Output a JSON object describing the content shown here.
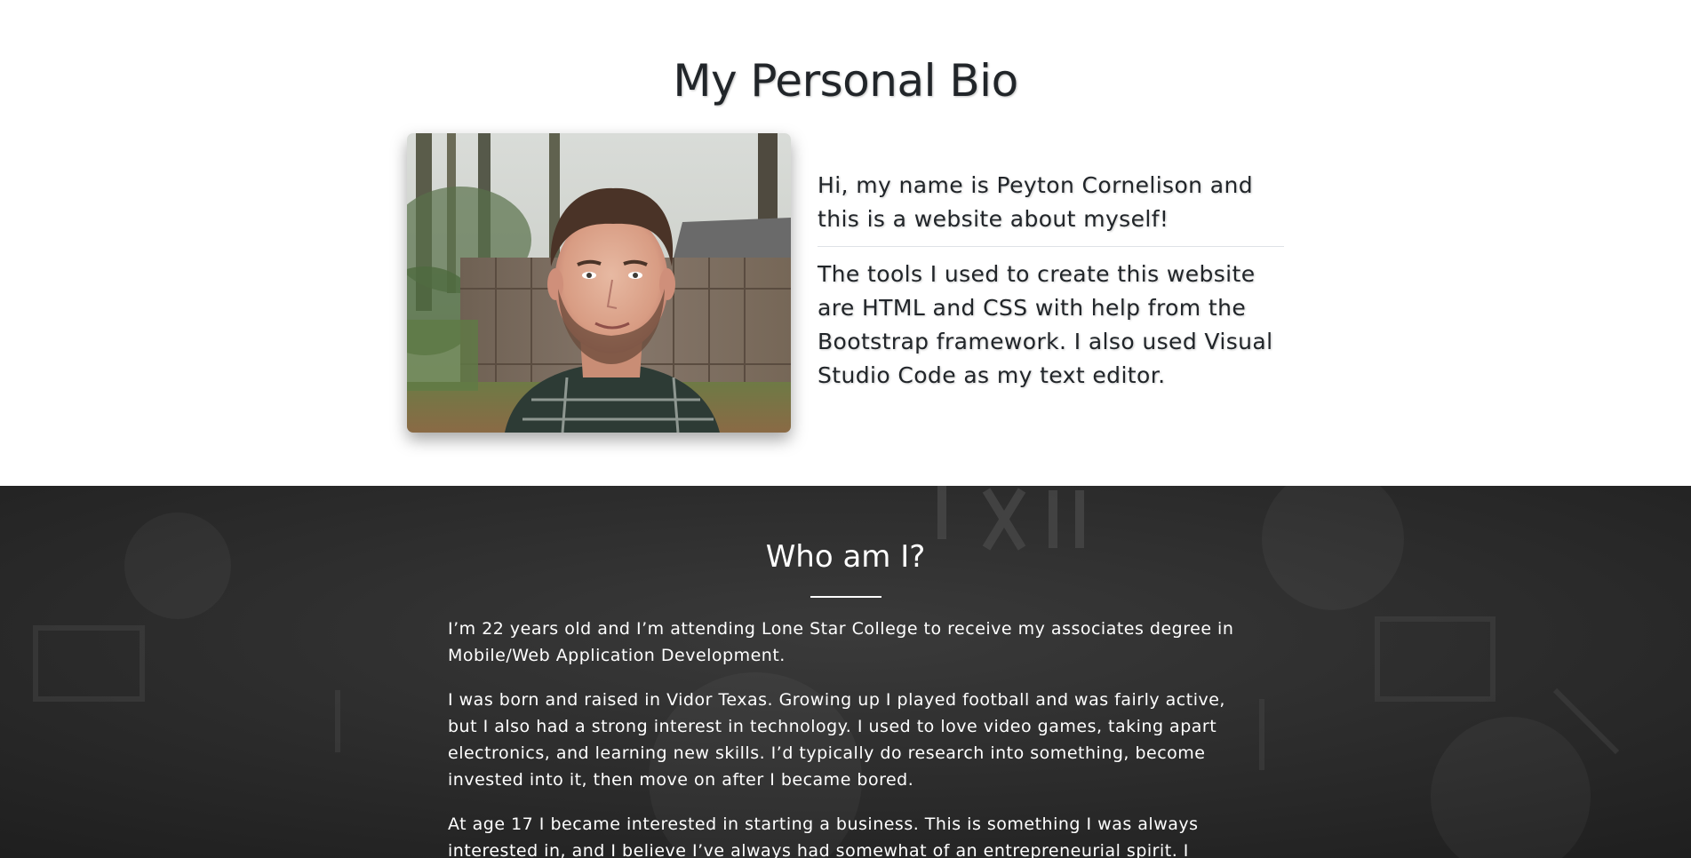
{
  "bio": {
    "title": "My Personal Bio",
    "portrait_alt": "Portrait photo",
    "intro": "Hi, my name is Peyton Cornelison and this is a website about myself!",
    "tools": "The tools I used to create this website are HTML and CSS with help from the Bootstrap framework. I also used Visual Studio Code as my text editor."
  },
  "who": {
    "title": "Who am I?",
    "paragraphs": [
      "I’m 22 years old and I’m attending Lone Star College to receive my associates degree in Mobile/Web Application Development.",
      "I was born and raised in Vidor Texas. Growing up I played football and was fairly active, but I also had a strong interest in technology. I used to love video games, taking apart electronics, and learning new skills. I’d typically do research into something, become invested into it, then move on after I became bored.",
      "At age 17 I became interested in starting a business. This is something I was always interested in, and I believe I’ve always had somewhat of an entrepreneurial spirit. I"
    ]
  },
  "colors": {
    "heading_text": "#212529",
    "dark_bg": "#2a2a2a",
    "light_text": "#ffffff"
  }
}
